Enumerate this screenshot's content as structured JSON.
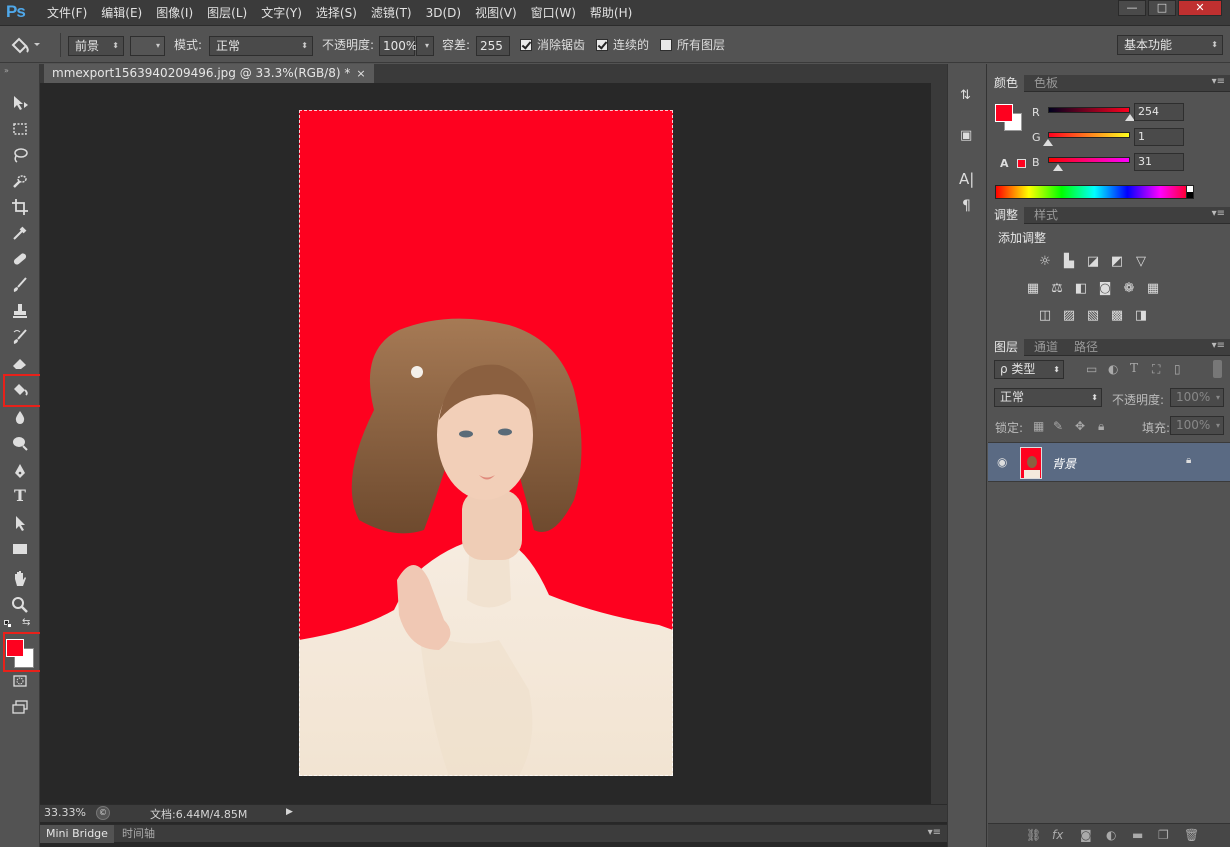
{
  "app": {
    "logo": "Ps"
  },
  "menu": [
    "文件(F)",
    "编辑(E)",
    "图像(I)",
    "图层(L)",
    "文字(Y)",
    "选择(S)",
    "滤镜(T)",
    "3D(D)",
    "视图(V)",
    "窗口(W)",
    "帮助(H)"
  ],
  "window_controls": {
    "minimize": "—",
    "restore": "□",
    "close": "✕"
  },
  "options": {
    "fill_source": "前景",
    "mode_label": "模式:",
    "mode_value": "正常",
    "opacity_label": "不透明度:",
    "opacity_value": "100%",
    "tolerance_label": "容差:",
    "tolerance_value": "255",
    "antialias_label": "消除锯齿",
    "contiguous_label": "连续的",
    "all_layers_label": "所有图层",
    "workspace": "基本功能"
  },
  "document": {
    "tab_title": "mmexport1563940209496.jpg @ 33.3%(RGB/8) *",
    "tab_close": "×",
    "zoom": "33.33%",
    "doc_size": "文档:6.44M/4.85M"
  },
  "bottom_tabs": [
    "Mini Bridge",
    "时间轴"
  ],
  "colors": {
    "foreground": "#fe011f",
    "background": "#ffffff",
    "canvas_red": "#fe011f",
    "highlight": "#e8211a"
  },
  "color_panel": {
    "tabs": [
      "颜色",
      "色板"
    ],
    "channels": [
      {
        "label": "R",
        "value": "254",
        "fraction": 0.996
      },
      {
        "label": "G",
        "value": "1",
        "fraction": 0.004
      },
      {
        "label": "B",
        "value": "31",
        "fraction": 0.12
      }
    ]
  },
  "adjust_panel": {
    "tabs": [
      "调整",
      "样式"
    ],
    "title": "添加调整",
    "icons": [
      "brightness-icon",
      "levels-icon",
      "curves-icon",
      "exposure-icon",
      "vibrance-icon",
      "hue-icon",
      "balance-icon",
      "bw-icon",
      "photo-filter-icon",
      "channel-mixer-icon",
      "lookup-icon",
      "invert-icon",
      "posterize-icon",
      "threshold-icon",
      "gradient-map-icon",
      "selective-color-icon"
    ]
  },
  "layers_panel": {
    "tabs": [
      "图层",
      "通道",
      "路径"
    ],
    "filter_label": "ρ 类型",
    "blend_mode": "正常",
    "opacity_label": "不透明度:",
    "opacity_value": "100%",
    "lock_label": "锁定:",
    "fill_label": "填充:",
    "fill_value": "100%",
    "layers": [
      {
        "name": "背景",
        "visible": true,
        "locked": true
      }
    ]
  }
}
